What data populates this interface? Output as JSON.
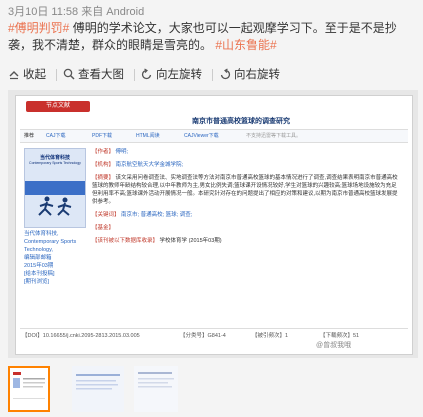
{
  "meta": {
    "date": "3月10日",
    "time": "11:58",
    "source_prefix": "来自",
    "source": "Android"
  },
  "post": {
    "tag1": "#傅明判罚#",
    "text": " 傅明的学术论文，大家也可以一起观摩学习下。至于是不是抄袭，我不清楚，群众的眼睛是雪亮的。",
    "tag2": "#山东鲁能#"
  },
  "toolbar": {
    "collapse": "收起",
    "view_large": "查看大图",
    "rotate_left": "向左旋转",
    "rotate_right": "向右旋转"
  },
  "doc": {
    "badge": "节点文献",
    "title": "南京市普通高校篮球的调查研究",
    "tools": {
      "recommend": "推荐",
      "caj": "CAJ下载",
      "pdf": "PDF下载",
      "html": "HTML阅读",
      "viewer": "CAJViewer下载",
      "unsupported": "不支持迅雷等下载工具。"
    },
    "cover": {
      "title": "当代体育科技",
      "title_en": "Contemporary Sports Technology"
    },
    "journal_info": [
      "当代体育科技,",
      "Contemporary Sports",
      "Technology,",
      "编辑部邮箱",
      "2015年03期",
      "[给本刊投稿]",
      "[期刊浏览]"
    ],
    "fields": {
      "author_label": "【作者】",
      "author": "傅明;",
      "org_label": "【机构】",
      "org": "南京航空航天大学金城学院;",
      "abstract_label": "【摘要】",
      "abstract": "该文采用问卷调查法、实地调查法等方法对南京市普通高校篮球的基本情况进行了调查,调查结果表明南京市普通高校篮球的教师年龄结构较合理,以中年教师为主,男女比例失调;篮球课开设情况较好,学生对篮球的兴趣较高;篮球场地设施较为充足但利用率不高;篮球课外活动开展情况一般。本研究针对存在的问题提出了相应的对策和建议,以期为南京市普通高校篮球发展提供参考。",
      "keywords_label": "【关键词】",
      "keywords": "南京市; 普通高校; 篮球; 调查;",
      "fund_label": "【基金】",
      "fund": "",
      "class_label": "【该刊被以下数据库收录】",
      "class": "学校体育学 (2015年03期)"
    },
    "bottom": {
      "doi": "【DOI】10.16655/j.cnki.2095-2813.2015.03.005",
      "classno": "【分类号】G841-4",
      "cited": "【被引频次】1",
      "downloads": "【下载频次】51"
    },
    "watermark": "@曾叔我哦"
  }
}
